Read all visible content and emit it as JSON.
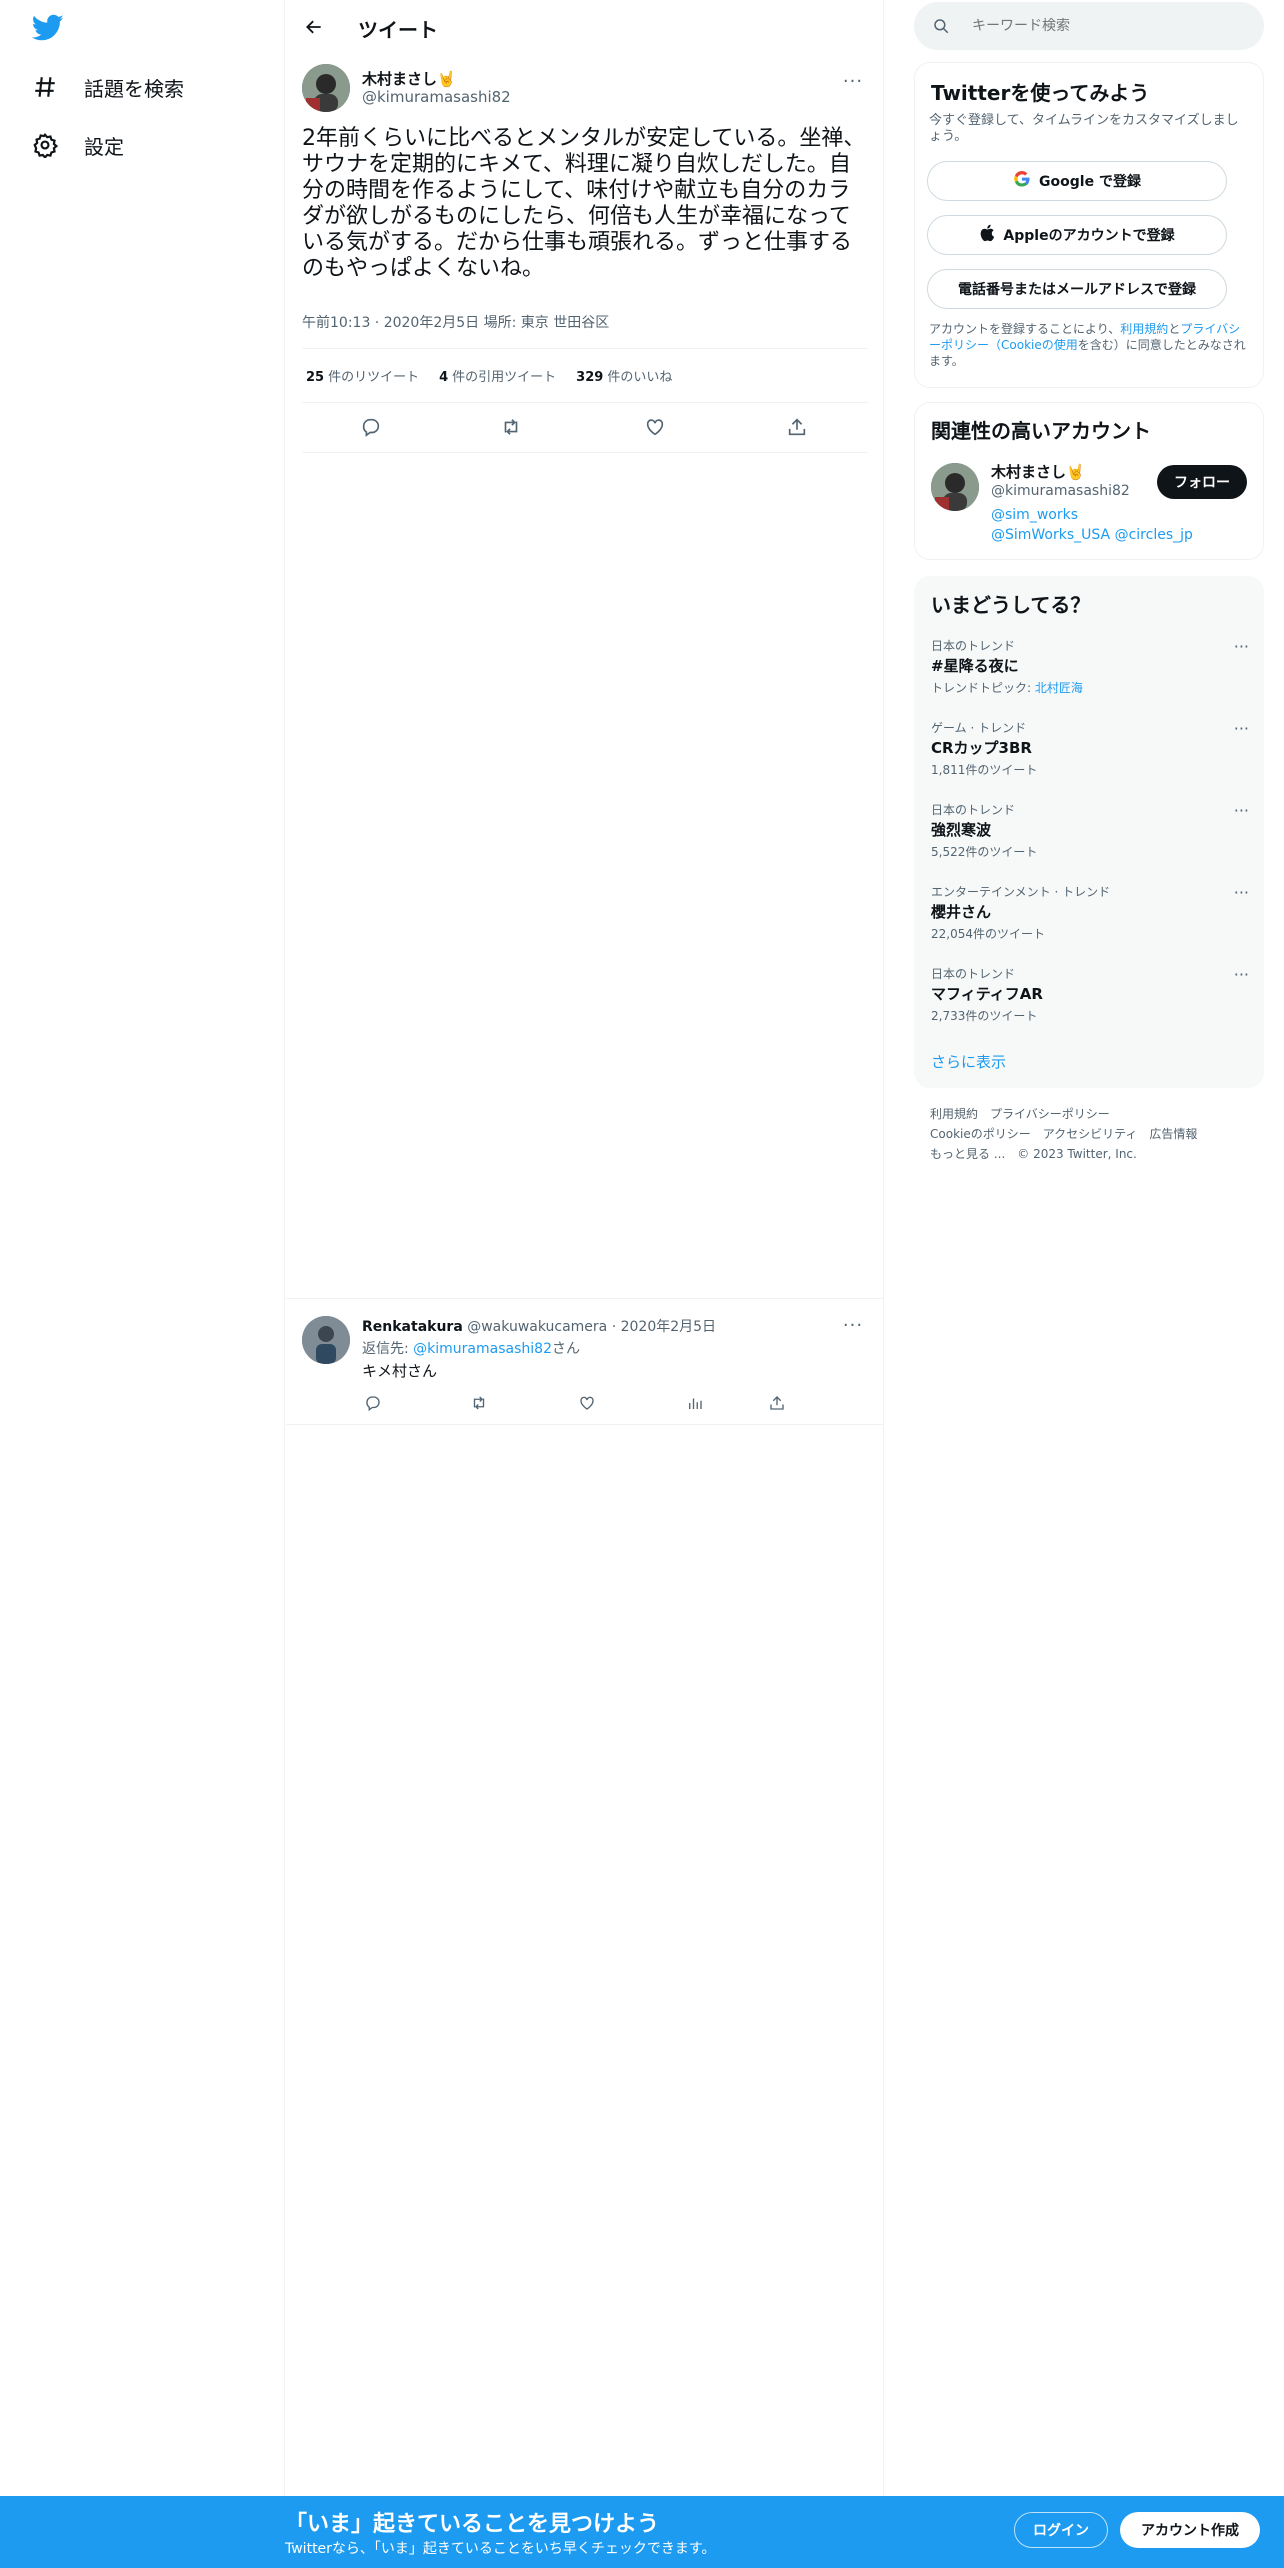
{
  "nav": {
    "logo_icon": "twitter-bird-icon",
    "items": [
      {
        "icon": "hashtag-icon",
        "label": "話題を検索"
      },
      {
        "icon": "gear-icon",
        "label": "設定"
      }
    ]
  },
  "header": {
    "back_icon": "arrow-left-icon",
    "title": "ツイート"
  },
  "tweet": {
    "author_name": "木村まさし🤘",
    "author_handle": "@kimuramasashi82",
    "text": "2年前くらいに比べるとメンタルが安定している。坐禅、サウナを定期的にキメて、料理に凝り自炊しだした。自分の時間を作るようにして、味付けや献立も自分のカラダが欲しがるものにしたら、何倍も人生が幸福になっている気がする。だから仕事も頑張れる。ずっと仕事するのもやっぱよくないね。",
    "meta": "午前10:13 · 2020年2月5日 場所: 東京 世田谷区",
    "stats": [
      {
        "count": "25",
        "label": "件のリツイート"
      },
      {
        "count": "4",
        "label": "件の引用ツイート"
      },
      {
        "count": "329",
        "label": "件のいいね"
      }
    ],
    "more": "···"
  },
  "reply": {
    "name": "Renkatakura",
    "handle": "@wakuwakucamera",
    "date": "· 2020年2月5日",
    "reply_to_prefix": "返信先: ",
    "reply_to_mention": "@kimuramasashi82",
    "reply_to_suffix": "さん",
    "text": "キメ村さん",
    "more": "···"
  },
  "sidebar": {
    "search_placeholder": "キーワード検索",
    "signup_card": {
      "title": "Twitterを使ってみよう",
      "subtitle": "今すぐ登録して、タイムラインをカスタマイズしましょう。",
      "google_btn": "Google で登録",
      "apple_btn": "Appleのアカウントで登録",
      "phone_btn": "電話番号またはメールアドレスで登録",
      "terms_prefix": "アカウントを登録することにより、",
      "terms_link1": "利用規約",
      "terms_mid": "と",
      "terms_link2": "プライバシーポリシー（Cookieの使用",
      "terms_suffix": "を含む）に同意したとみなされます。"
    },
    "related": {
      "title": "関連性の高いアカウント",
      "name": "木村まさし🤘",
      "handle": "@kimuramasashi82",
      "links": "@sim_works @SimWorks_USA @circles_jp",
      "follow_btn": "フォロー"
    },
    "trends": {
      "title": "いまどうしてる？",
      "items": [
        {
          "category": "日本のトレンド",
          "name": "#星降る夜に",
          "sub_prefix": "トレンドトピック: ",
          "sub_link": "北村匠海"
        },
        {
          "category": "ゲーム · トレンド",
          "name": "CRカップ3BR",
          "sub_prefix": "1,811件のツイート",
          "sub_link": ""
        },
        {
          "category": "日本のトレンド",
          "name": "強烈寒波",
          "sub_prefix": "5,522件のツイート",
          "sub_link": ""
        },
        {
          "category": "エンターテインメント · トレンド",
          "name": "櫻井さん",
          "sub_prefix": "22,054件のツイート",
          "sub_link": ""
        },
        {
          "category": "日本のトレンド",
          "name": "マフィティフAR",
          "sub_prefix": "2,733件のツイート",
          "sub_link": ""
        }
      ],
      "more_icon": "···",
      "show_more": "さらに表示"
    },
    "footer": {
      "links": [
        "利用規約",
        "プライバシーポリシー",
        "Cookieのポリシー",
        "アクセシビリティ",
        "広告情報",
        "もっと見る ..."
      ],
      "copyright": "© 2023 Twitter, Inc."
    }
  },
  "bottom_bar": {
    "title": "「いま」起きていることを見つけよう",
    "subtitle": "Twitterなら、「いま」起きていることをいち早くチェックできます。",
    "login": "ログイン",
    "signup": "アカウント作成"
  },
  "colors": {
    "accent": "#1d9bf0",
    "text": "#0f1419",
    "muted": "#536471",
    "border": "#eff3f4"
  }
}
